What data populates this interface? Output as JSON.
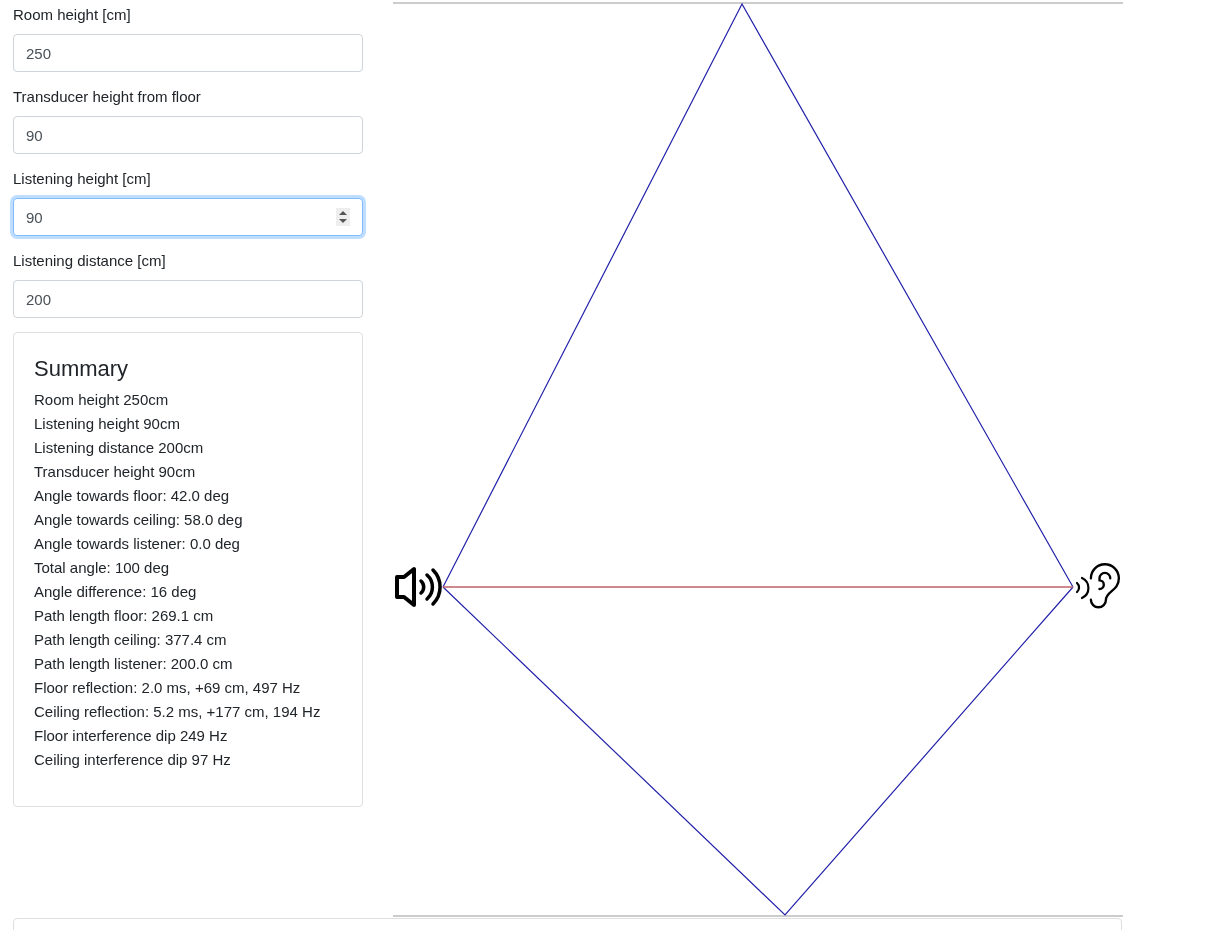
{
  "fields": [
    {
      "label": "Room height [cm]",
      "value": "250",
      "focused": false
    },
    {
      "label": "Transducer height from floor",
      "value": "90",
      "focused": false
    },
    {
      "label": "Listening height [cm]",
      "value": "90",
      "focused": true
    },
    {
      "label": "Listening distance [cm]",
      "value": "200",
      "focused": false
    }
  ],
  "summary": {
    "title": "Summary",
    "lines": [
      "Room height 250cm",
      "Listening height 90cm",
      "Listening distance 200cm",
      "Transducer height 90cm",
      "Angle towards floor: 42.0 deg",
      "Angle towards ceiling: 58.0 deg",
      "Angle towards listener: 0.0 deg",
      "Total angle: 100 deg",
      "Angle difference: 16 deg",
      "Path length floor: 269.1 cm",
      "Path length ceiling: 377.4 cm",
      "Path length listener: 200.0 cm",
      "Floor reflection: 2.0 ms, +69 cm, 497 Hz",
      "Ceiling reflection: 5.2 ms, +177 cm, 194 Hz",
      "Floor interference dip 249 Hz",
      "Ceiling interference dip 97 Hz"
    ]
  }
}
